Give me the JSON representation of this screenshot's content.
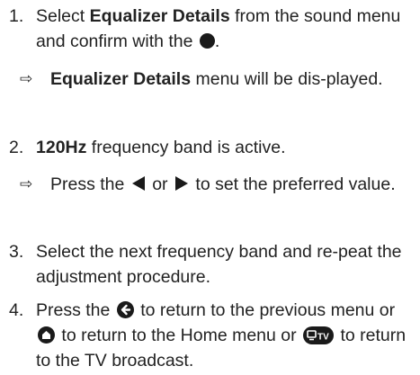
{
  "steps": [
    {
      "number": "1.",
      "pre": "Select ",
      "bold": "Equalizer Details",
      "post": " from the sound menu and confirm with the ",
      "end": ".",
      "result": {
        "bold": "Equalizer Details",
        "post": " menu will be dis-played."
      }
    },
    {
      "number": "2.",
      "bold": "120Hz",
      "post": " frequency band is active.",
      "result": {
        "pre": "Press the ",
        "mid": " or ",
        "post": " to set the preferred value."
      }
    },
    {
      "number": "3.",
      "text": "Select the next frequency band and re-peat the adjustment procedure."
    },
    {
      "number": "4.",
      "a": "Press the ",
      "b": " to return to the previous menu or ",
      "c": " to return to the Home menu or ",
      "d": " to return to the TV broadcast."
    }
  ],
  "result_marker": "⇨",
  "icons": [
    "ok-button-icon",
    "left-arrow-icon",
    "right-arrow-icon",
    "back-button-icon",
    "home-button-icon",
    "tv-button-icon"
  ]
}
